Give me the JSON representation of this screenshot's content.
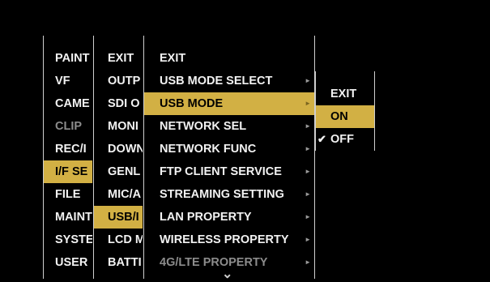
{
  "menu1": {
    "items": [
      {
        "label": "PAINT",
        "state": "normal"
      },
      {
        "label": "VF",
        "state": "normal"
      },
      {
        "label": "CAME",
        "state": "normal"
      },
      {
        "label": "CLIP",
        "state": "dim"
      },
      {
        "label": "REC/I",
        "state": "normal"
      },
      {
        "label": "I/F SE",
        "state": "selected"
      },
      {
        "label": "FILE",
        "state": "normal"
      },
      {
        "label": "MAINT",
        "state": "normal"
      },
      {
        "label": "SYSTE",
        "state": "normal"
      },
      {
        "label": "USER",
        "state": "normal"
      }
    ]
  },
  "menu2": {
    "items": [
      {
        "label": "EXIT",
        "state": "normal"
      },
      {
        "label": "OUTP",
        "state": "normal"
      },
      {
        "label": "SDI O",
        "state": "normal"
      },
      {
        "label": "MONI",
        "state": "normal"
      },
      {
        "label": "DOWN",
        "state": "normal"
      },
      {
        "label": "GENL",
        "state": "normal"
      },
      {
        "label": "MIC/A",
        "state": "normal"
      },
      {
        "label": "USB/I",
        "state": "selected"
      },
      {
        "label": "LCD M",
        "state": "normal"
      },
      {
        "label": "BATTI",
        "state": "normal"
      }
    ]
  },
  "menu3": {
    "items": [
      {
        "label": "EXIT",
        "state": "normal",
        "submenu": false
      },
      {
        "label": "USB MODE SELECT",
        "state": "normal",
        "submenu": true
      },
      {
        "label": "USB MODE",
        "state": "selected",
        "submenu": true
      },
      {
        "label": "NETWORK SEL",
        "state": "normal",
        "submenu": true
      },
      {
        "label": "NETWORK FUNC",
        "state": "normal",
        "submenu": true
      },
      {
        "label": "FTP CLIENT SERVICE",
        "state": "normal",
        "submenu": true
      },
      {
        "label": "STREAMING SETTING",
        "state": "normal",
        "submenu": true
      },
      {
        "label": "LAN PROPERTY",
        "state": "normal",
        "submenu": true
      },
      {
        "label": "WIRELESS PROPERTY",
        "state": "normal",
        "submenu": true
      },
      {
        "label": "4G/LTE PROPERTY",
        "state": "dim",
        "submenu": true
      }
    ],
    "more_icon": "chevron-down-icon"
  },
  "menu4": {
    "items": [
      {
        "label": "EXIT",
        "state": "normal",
        "checked": false
      },
      {
        "label": "ON",
        "state": "selected",
        "checked": false
      },
      {
        "label": "OFF",
        "state": "normal",
        "checked": true
      }
    ]
  },
  "glyphs": {
    "arrow": "►",
    "check": "✔",
    "more": "⌄"
  },
  "colors": {
    "background": "#000000",
    "highlight": "#d2b044",
    "text": "#f2f2f2",
    "dim": "#8c8c8c",
    "divider": "#cfcfcf"
  }
}
